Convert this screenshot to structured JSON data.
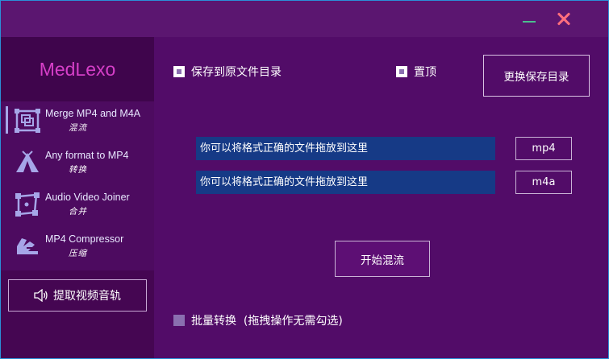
{
  "app": {
    "logo": "MedLexo"
  },
  "titlebar": {
    "minimize_label": "—",
    "close_label": "✕"
  },
  "sidebar": {
    "items": [
      {
        "title": "Merge MP4 and M4A",
        "subtitle": "混流",
        "icon": "merge-icon",
        "active": true
      },
      {
        "title": "Any format to MP4",
        "subtitle": "转换",
        "icon": "convert-icon",
        "active": false
      },
      {
        "title": "Audio Video Joiner",
        "subtitle": "合并",
        "icon": "joiner-icon",
        "active": false
      },
      {
        "title": "MP4 Compressor",
        "subtitle": "压缩",
        "icon": "compressor-icon",
        "active": false
      }
    ],
    "extract_button": {
      "label": "提取视频音轨",
      "icon": "speaker-icon"
    }
  },
  "main": {
    "save_to_source": {
      "label": "保存到原文件目录",
      "checked": true
    },
    "pin_top": {
      "label": "置顶",
      "checked": true
    },
    "change_dir_button": "更换保存目录",
    "drop_fields": [
      {
        "text": "你可以将格式正确的文件拖放到这里",
        "button": "mp4"
      },
      {
        "text": "你可以将格式正确的文件拖放到这里",
        "button": "m4a"
      }
    ],
    "start_button": "开始混流",
    "batch_convert": {
      "label": "批量转换  (拖拽操作无需勾选)",
      "checked": false
    }
  },
  "colors": {
    "background": "#520c68",
    "sidebar": "#450652",
    "logo_text": "#d63fc8",
    "drop_field": "#163a86",
    "close": "#ff6f7d",
    "minimize": "#4bbf8e"
  }
}
